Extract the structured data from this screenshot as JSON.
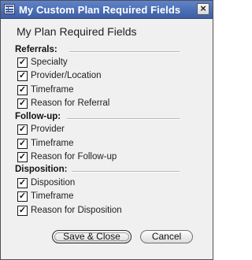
{
  "window": {
    "title": "My Custom Plan Required Fields",
    "close_glyph": "×"
  },
  "dialog": {
    "heading": "My Plan Required Fields",
    "sections": [
      {
        "label": "Referrals:",
        "items": [
          {
            "label": "Specialty",
            "checked": true
          },
          {
            "label": "Provider/Location",
            "checked": true
          },
          {
            "label": "Timeframe",
            "checked": true
          },
          {
            "label": "Reason for Referral",
            "checked": true
          }
        ]
      },
      {
        "label": "Follow-up:",
        "items": [
          {
            "label": "Provider",
            "checked": true
          },
          {
            "label": "Timeframe",
            "checked": true
          },
          {
            "label": "Reason for Follow-up",
            "checked": true
          }
        ]
      },
      {
        "label": "Disposition:",
        "items": [
          {
            "label": "Disposition",
            "checked": true
          },
          {
            "label": "Timeframe",
            "checked": true
          },
          {
            "label": "Reason for Disposition",
            "checked": true
          }
        ]
      }
    ],
    "check_glyph": "✓"
  },
  "buttons": {
    "save_label": "Save & Close",
    "cancel_label": "Cancel"
  },
  "colors": {
    "titlebar": "#4a6db8",
    "dialog_bg": "#f0f0f0"
  }
}
